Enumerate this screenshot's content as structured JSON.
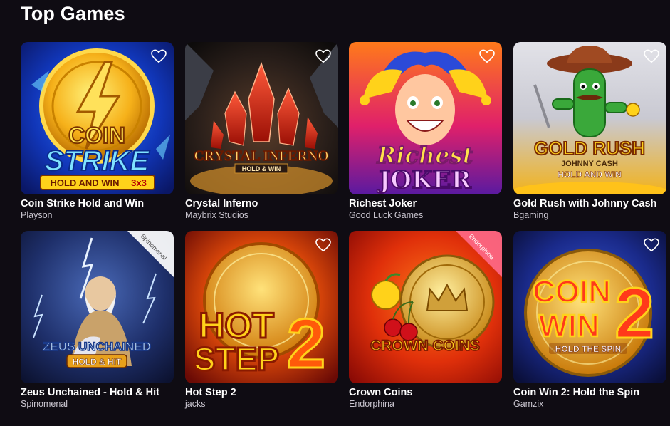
{
  "section": {
    "title": "Top Games"
  },
  "colors": {
    "background": "#0f0c13",
    "provider_text": "#c9c5cf"
  },
  "games": [
    {
      "title": "Coin Strike Hold and Win",
      "provider": "Playson",
      "art": {
        "line1": "COIN",
        "line2": "STRIKE",
        "badge": "HOLD AND WIN",
        "badge_extra": "3x3",
        "icon": "lightning-coin-icon"
      }
    },
    {
      "title": "Crystal Inferno",
      "provider": "Maybrix Studios",
      "art": {
        "line1": "CRYSTAL INFERNO",
        "badge": "HOLD & WIN",
        "icon": "red-crystal-icon"
      }
    },
    {
      "title": "Richest Joker",
      "provider": "Good Luck Games",
      "art": {
        "line1": "Richest",
        "line2": "JOKER",
        "icon": "joker-face-icon"
      }
    },
    {
      "title": "Gold Rush with Johnny Cash",
      "provider": "Bgaming",
      "art": {
        "line1": "GOLD RUSH",
        "line2": "JOHNNY CASH",
        "badge": "HOLD AND WIN",
        "icon": "cactus-cowboy-icon"
      }
    },
    {
      "title": "Zeus Unchained - Hold & Hit",
      "provider": "Spinomenal",
      "art": {
        "line1": "ZEUS UNCHAINED",
        "badge": "HOLD & HIT",
        "ribbon": "Spinomenal",
        "icon": "zeus-lightning-icon"
      }
    },
    {
      "title": "Hot Step 2",
      "provider": "jacks",
      "art": {
        "line1": "HOT",
        "line2": "STEP",
        "number": "2",
        "icon": "hot-coin-icon"
      }
    },
    {
      "title": "Crown Coins",
      "provider": "Endorphina",
      "art": {
        "line1": "CROWN COINS",
        "ribbon": "Endorphina",
        "icon": "crown-coin-icon"
      }
    },
    {
      "title": "Coin Win 2: Hold the Spin",
      "provider": "Gamzix",
      "art": {
        "line1": "COIN",
        "line2": "WIN",
        "number": "2",
        "badge": "HOLD THE SPIN",
        "icon": "gold-coin-icon"
      }
    }
  ]
}
